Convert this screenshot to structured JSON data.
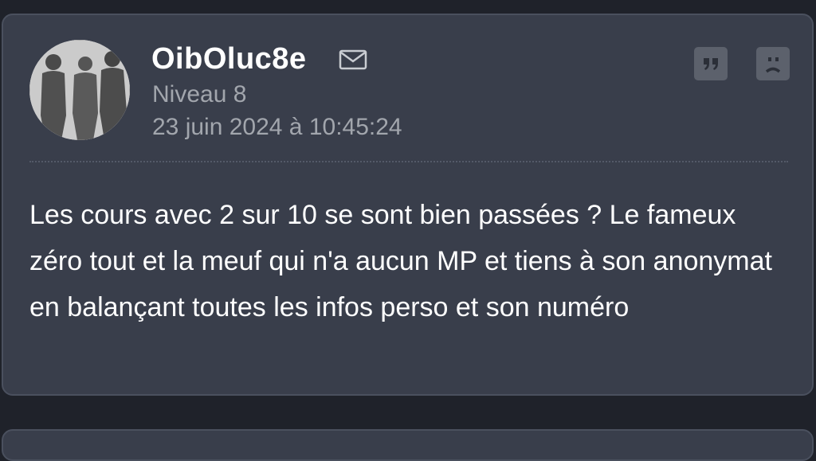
{
  "post": {
    "author": {
      "username": "OibOluc8e",
      "level": "Niveau 8",
      "avatar_icon": "group-silhouette-avatar"
    },
    "timestamp": "23 juin 2024 à 10:45:24",
    "message": "Les cours avec 2 sur 10 se sont bien passées ? Le fameux zéro tout et la meuf qui n'a aucun MP et tiens à son anonymat en balançant toutes les infos perso et son numéro",
    "actions": {
      "message_icon": "envelope-icon",
      "quote_icon": "quote-icon",
      "report_icon": "sad-face-icon"
    }
  },
  "theme": {
    "background": "#1f222a",
    "card": "#393e4b",
    "card_border": "#4a505e",
    "text": "#ffffff",
    "muted_text": "#a2a6ad",
    "button": "#5c616c"
  }
}
